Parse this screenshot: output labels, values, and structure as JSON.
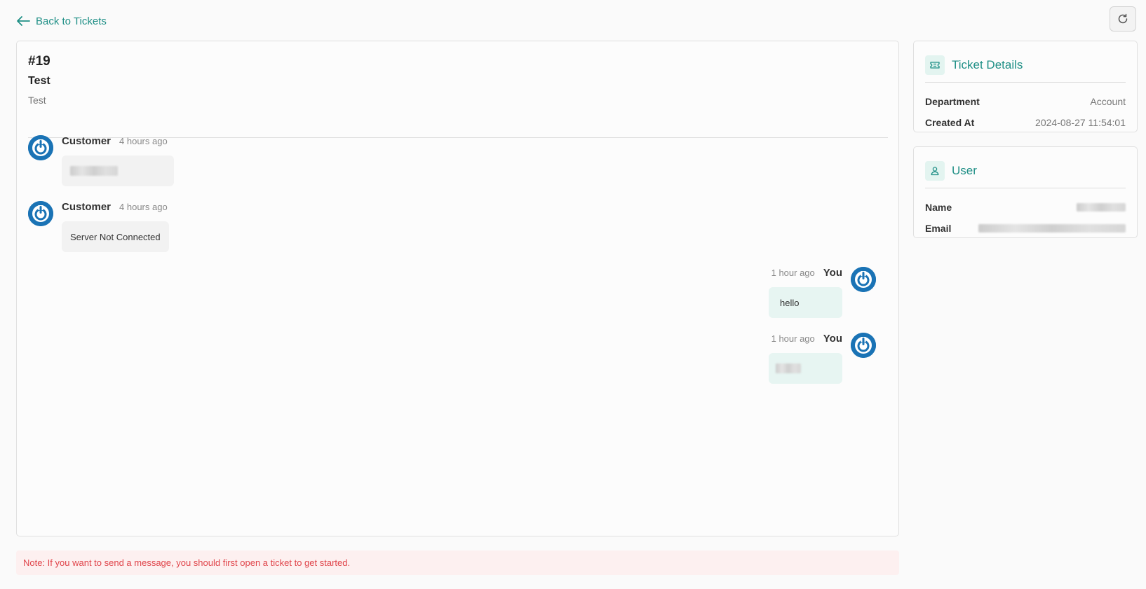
{
  "nav": {
    "back_label": "Back to Tickets"
  },
  "ticket": {
    "number": "#19",
    "subject": "Test",
    "description": "Test"
  },
  "messages": [
    {
      "author": "Customer",
      "time": "4 hours ago",
      "text": ""
    },
    {
      "author": "Customer",
      "time": "4 hours ago",
      "text": "Server Not Connected"
    },
    {
      "author": "You",
      "time": "1 hour ago",
      "text": "hello"
    },
    {
      "author": "You",
      "time": "1 hour ago",
      "text": ""
    }
  ],
  "note": "Note:  If you want to send a message, you should first open a ticket to get started.",
  "ticket_details": {
    "title": "Ticket Details",
    "department_label": "Department",
    "department_value": "Account",
    "created_label": "Created At",
    "created_value": "2024-08-27 11:54:01"
  },
  "user": {
    "title": "User",
    "name_label": "Name",
    "email_label": "Email"
  },
  "colors": {
    "accent": "#1f8f86",
    "avatar": "#1a73b5",
    "note_text": "#e0444a",
    "note_bg": "#fdf0f0",
    "own_bubble": "#e7f5f2"
  },
  "icons": {
    "back": "arrow-left-icon",
    "refresh": "refresh-icon",
    "ticket": "ticket-icon",
    "user": "user-icon",
    "avatar": "power-icon"
  }
}
